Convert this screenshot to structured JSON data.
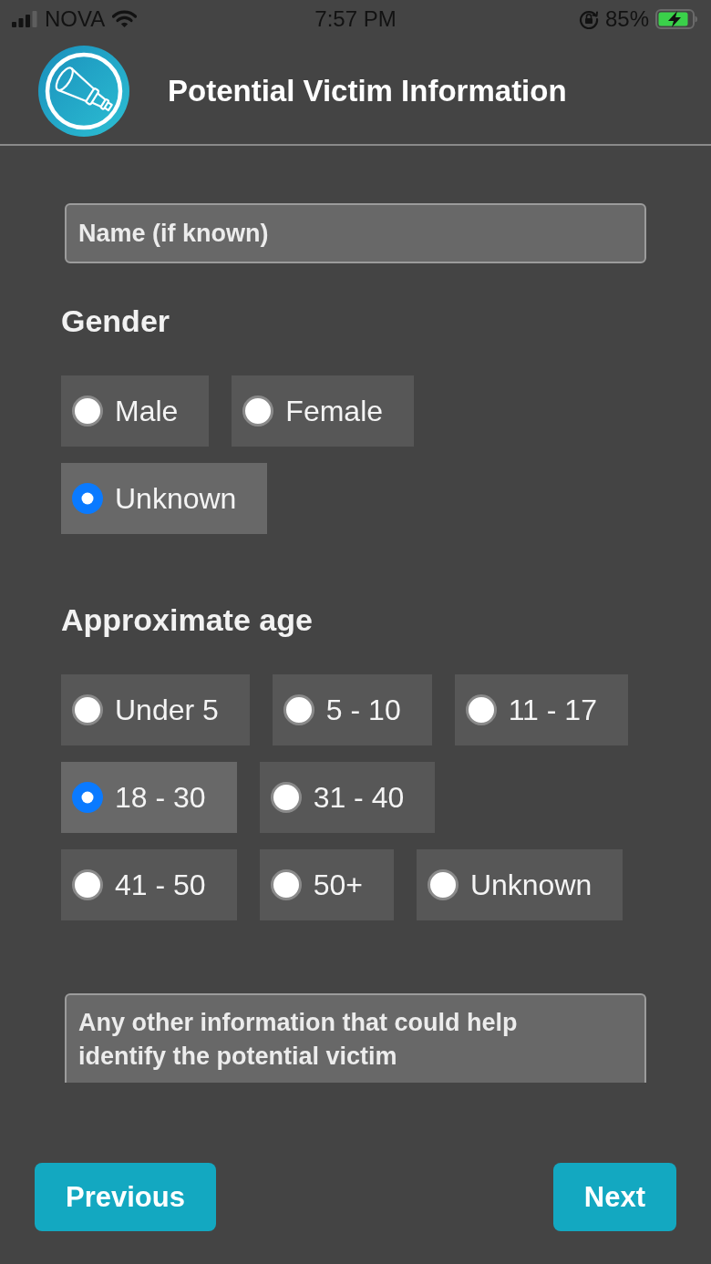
{
  "status_bar": {
    "carrier": "NOVA",
    "time": "7:57 PM",
    "battery": "85%"
  },
  "header": {
    "title": "Potential Victim Information"
  },
  "name_field": {
    "placeholder": "Name (if known)"
  },
  "gender": {
    "label": "Gender",
    "rows": [
      [
        {
          "label": "Male",
          "selected": false
        },
        {
          "label": "Female",
          "selected": false
        }
      ],
      [
        {
          "label": "Unknown",
          "selected": true
        }
      ]
    ]
  },
  "age": {
    "label": "Approximate age",
    "rows": [
      [
        {
          "label": "Under 5",
          "selected": false
        },
        {
          "label": "5 - 10",
          "selected": false
        },
        {
          "label": "11 - 17",
          "selected": false
        }
      ],
      [
        {
          "label": "18 - 30",
          "selected": true
        },
        {
          "label": "31 - 40",
          "selected": false
        }
      ],
      [
        {
          "label": "41 - 50",
          "selected": false
        },
        {
          "label": "50+",
          "selected": false
        },
        {
          "label": "Unknown",
          "selected": false
        }
      ]
    ]
  },
  "details_field": {
    "placeholder": "Any other information that could help identify the potential victim"
  },
  "buttons": [
    {
      "label": "Previous"
    },
    {
      "label": "Next"
    }
  ]
}
